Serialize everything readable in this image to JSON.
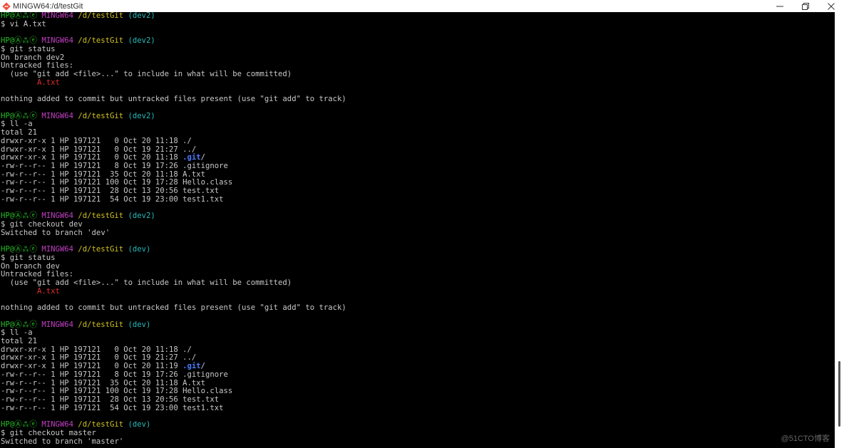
{
  "window": {
    "title": "MINGW64:/d/testGit",
    "app_icon": "git-bash-icon",
    "controls": [
      "minimize-icon",
      "restore-icon",
      "close-icon"
    ]
  },
  "colors": {
    "background": "#000000",
    "prompt_user": "#25bc24",
    "prompt_env": "#c23fc2",
    "prompt_path": "#d0c020",
    "prompt_branch": "#27b9ba",
    "untracked_file": "#e22b2b",
    "directory": "#4b7bff"
  },
  "terminal": {
    "lines": [
      [
        {
          "t": "HP@Ⓐ⁂ⓔ",
          "c": "green"
        },
        {
          "t": " "
        },
        {
          "t": "MINGW64",
          "c": "magenta"
        },
        {
          "t": " "
        },
        {
          "t": "/d/testGit",
          "c": "yellow"
        },
        {
          "t": " "
        },
        {
          "t": "(dev2)",
          "c": "cyan"
        }
      ],
      [
        {
          "t": "$ vi A.txt"
        }
      ],
      [
        {
          "t": ""
        }
      ],
      [
        {
          "t": "HP@Ⓐ⁂ⓔ",
          "c": "green"
        },
        {
          "t": " "
        },
        {
          "t": "MINGW64",
          "c": "magenta"
        },
        {
          "t": " "
        },
        {
          "t": "/d/testGit",
          "c": "yellow"
        },
        {
          "t": " "
        },
        {
          "t": "(dev2)",
          "c": "cyan"
        }
      ],
      [
        {
          "t": "$ git status"
        }
      ],
      [
        {
          "t": "On branch dev2"
        }
      ],
      [
        {
          "t": "Untracked files:"
        }
      ],
      [
        {
          "t": "  (use \"git add <file>...\" to include in what will be committed)"
        }
      ],
      [
        {
          "t": "        "
        },
        {
          "t": "A.txt",
          "c": "red"
        }
      ],
      [
        {
          "t": ""
        }
      ],
      [
        {
          "t": "nothing added to commit but untracked files present (use \"git add\" to track)"
        }
      ],
      [
        {
          "t": ""
        }
      ],
      [
        {
          "t": "HP@Ⓐ⁂ⓔ",
          "c": "green"
        },
        {
          "t": " "
        },
        {
          "t": "MINGW64",
          "c": "magenta"
        },
        {
          "t": " "
        },
        {
          "t": "/d/testGit",
          "c": "yellow"
        },
        {
          "t": " "
        },
        {
          "t": "(dev2)",
          "c": "cyan"
        }
      ],
      [
        {
          "t": "$ ll -a"
        }
      ],
      [
        {
          "t": "total 21"
        }
      ],
      [
        {
          "t": "drwxr-xr-x 1 HP 197121   0 Oct 20 11:18 ./"
        }
      ],
      [
        {
          "t": "drwxr-xr-x 1 HP 197121   0 Oct 19 21:27 ../"
        }
      ],
      [
        {
          "t": "drwxr-xr-x 1 HP 197121   0 Oct 20 11:18 "
        },
        {
          "t": ".git",
          "c": "blue"
        },
        {
          "t": "/"
        }
      ],
      [
        {
          "t": "-rw-r--r-- 1 HP 197121   8 Oct 19 17:26 .gitignore"
        }
      ],
      [
        {
          "t": "-rw-r--r-- 1 HP 197121  35 Oct 20 11:18 A.txt"
        }
      ],
      [
        {
          "t": "-rw-r--r-- 1 HP 197121 100 Oct 19 17:28 Hello.class"
        }
      ],
      [
        {
          "t": "-rw-r--r-- 1 HP 197121  28 Oct 13 20:56 test.txt"
        }
      ],
      [
        {
          "t": "-rw-r--r-- 1 HP 197121  54 Oct 19 23:00 test1.txt"
        }
      ],
      [
        {
          "t": ""
        }
      ],
      [
        {
          "t": "HP@Ⓐ⁂ⓔ",
          "c": "green"
        },
        {
          "t": " "
        },
        {
          "t": "MINGW64",
          "c": "magenta"
        },
        {
          "t": " "
        },
        {
          "t": "/d/testGit",
          "c": "yellow"
        },
        {
          "t": " "
        },
        {
          "t": "(dev2)",
          "c": "cyan"
        }
      ],
      [
        {
          "t": "$ git checkout dev"
        }
      ],
      [
        {
          "t": "Switched to branch 'dev'"
        }
      ],
      [
        {
          "t": ""
        }
      ],
      [
        {
          "t": "HP@Ⓐ⁂ⓔ",
          "c": "green"
        },
        {
          "t": " "
        },
        {
          "t": "MINGW64",
          "c": "magenta"
        },
        {
          "t": " "
        },
        {
          "t": "/d/testGit",
          "c": "yellow"
        },
        {
          "t": " "
        },
        {
          "t": "(dev)",
          "c": "cyan"
        }
      ],
      [
        {
          "t": "$ git status"
        }
      ],
      [
        {
          "t": "On branch dev"
        }
      ],
      [
        {
          "t": "Untracked files:"
        }
      ],
      [
        {
          "t": "  (use \"git add <file>...\" to include in what will be committed)"
        }
      ],
      [
        {
          "t": "        "
        },
        {
          "t": "A.txt",
          "c": "red"
        }
      ],
      [
        {
          "t": ""
        }
      ],
      [
        {
          "t": "nothing added to commit but untracked files present (use \"git add\" to track)"
        }
      ],
      [
        {
          "t": ""
        }
      ],
      [
        {
          "t": "HP@Ⓐ⁂ⓔ",
          "c": "green"
        },
        {
          "t": " "
        },
        {
          "t": "MINGW64",
          "c": "magenta"
        },
        {
          "t": " "
        },
        {
          "t": "/d/testGit",
          "c": "yellow"
        },
        {
          "t": " "
        },
        {
          "t": "(dev)",
          "c": "cyan"
        }
      ],
      [
        {
          "t": "$ ll -a"
        }
      ],
      [
        {
          "t": "total 21"
        }
      ],
      [
        {
          "t": "drwxr-xr-x 1 HP 197121   0 Oct 20 11:18 ./"
        }
      ],
      [
        {
          "t": "drwxr-xr-x 1 HP 197121   0 Oct 19 21:27 ../"
        }
      ],
      [
        {
          "t": "drwxr-xr-x 1 HP 197121   0 Oct 20 11:19 "
        },
        {
          "t": ".git",
          "c": "blue"
        },
        {
          "t": "/"
        }
      ],
      [
        {
          "t": "-rw-r--r-- 1 HP 197121   8 Oct 19 17:26 .gitignore"
        }
      ],
      [
        {
          "t": "-rw-r--r-- 1 HP 197121  35 Oct 20 11:18 A.txt"
        }
      ],
      [
        {
          "t": "-rw-r--r-- 1 HP 197121 100 Oct 19 17:28 Hello.class"
        }
      ],
      [
        {
          "t": "-rw-r--r-- 1 HP 197121  28 Oct 13 20:56 test.txt"
        }
      ],
      [
        {
          "t": "-rw-r--r-- 1 HP 197121  54 Oct 19 23:00 test1.txt"
        }
      ],
      [
        {
          "t": ""
        }
      ],
      [
        {
          "t": "HP@Ⓐ⁂ⓔ",
          "c": "green"
        },
        {
          "t": " "
        },
        {
          "t": "MINGW64",
          "c": "magenta"
        },
        {
          "t": " "
        },
        {
          "t": "/d/testGit",
          "c": "yellow"
        },
        {
          "t": " "
        },
        {
          "t": "(dev)",
          "c": "cyan"
        }
      ],
      [
        {
          "t": "$ git checkout master"
        }
      ],
      [
        {
          "t": "Switched to branch 'master'"
        }
      ]
    ]
  },
  "watermark": "@51CTO博客"
}
